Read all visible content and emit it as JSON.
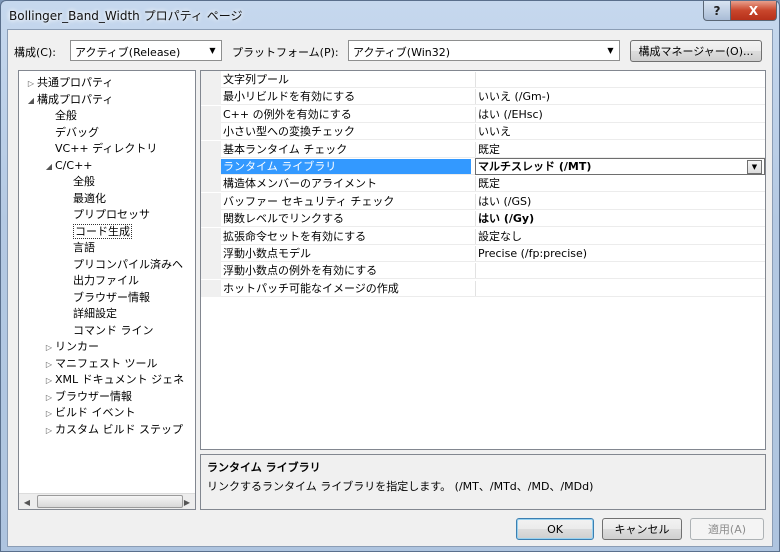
{
  "window": {
    "title": "Bollinger_Band_Width プロパティ ページ",
    "help_glyph": "?",
    "close_glyph": "X"
  },
  "toolbar": {
    "config_label": "構成(C):",
    "config_value": "アクティブ(Release)",
    "platform_label": "プラットフォーム(P):",
    "platform_value": "アクティブ(Win32)",
    "config_manager_button": "構成マネージャー(O)..."
  },
  "tree": {
    "expand_glyph": "▷",
    "collapse_glyph": "◢",
    "items": [
      {
        "label": "共通プロパティ",
        "level": 0,
        "state": "collapsed"
      },
      {
        "label": "構成プロパティ",
        "level": 0,
        "state": "expanded"
      },
      {
        "label": "全般",
        "level": 1,
        "state": "leaf"
      },
      {
        "label": "デバッグ",
        "level": 1,
        "state": "leaf"
      },
      {
        "label": "VC++ ディレクトリ",
        "level": 1,
        "state": "leaf"
      },
      {
        "label": "C/C++",
        "level": 1,
        "state": "expanded"
      },
      {
        "label": "全般",
        "level": 2,
        "state": "leaf"
      },
      {
        "label": "最適化",
        "level": 2,
        "state": "leaf"
      },
      {
        "label": "プリプロセッサ",
        "level": 2,
        "state": "leaf"
      },
      {
        "label": "コード生成",
        "level": 2,
        "state": "leaf",
        "selected": true
      },
      {
        "label": "言語",
        "level": 2,
        "state": "leaf"
      },
      {
        "label": "プリコンパイル済みヘ",
        "level": 2,
        "state": "leaf"
      },
      {
        "label": "出力ファイル",
        "level": 2,
        "state": "leaf"
      },
      {
        "label": "ブラウザー情報",
        "level": 2,
        "state": "leaf"
      },
      {
        "label": "詳細設定",
        "level": 2,
        "state": "leaf"
      },
      {
        "label": "コマンド ライン",
        "level": 2,
        "state": "leaf"
      },
      {
        "label": "リンカー",
        "level": 1,
        "state": "collapsed"
      },
      {
        "label": "マニフェスト ツール",
        "level": 1,
        "state": "collapsed"
      },
      {
        "label": "XML ドキュメント ジェネ",
        "level": 1,
        "state": "collapsed"
      },
      {
        "label": "ブラウザー情報",
        "level": 1,
        "state": "collapsed"
      },
      {
        "label": "ビルド イベント",
        "level": 1,
        "state": "collapsed"
      },
      {
        "label": "カスタム ビルド ステップ",
        "level": 1,
        "state": "collapsed"
      }
    ],
    "scroll_left_glyph": "◀",
    "scroll_right_glyph": "▶"
  },
  "properties": {
    "rows": [
      {
        "name": "文字列プール",
        "value": "",
        "bold": false
      },
      {
        "name": "最小リビルドを有効にする",
        "value": "いいえ (/Gm-)",
        "bold": false
      },
      {
        "name": "C++ の例外を有効にする",
        "value": "はい (/EHsc)",
        "bold": false
      },
      {
        "name": "小さい型への変換チェック",
        "value": "いいえ",
        "bold": false
      },
      {
        "name": "基本ランタイム チェック",
        "value": "既定",
        "bold": false
      },
      {
        "name": "ランタイム ライブラリ",
        "value": "マルチスレッド (/MT)",
        "bold": true,
        "selected": true
      },
      {
        "name": "構造体メンバーのアライメント",
        "value": "既定",
        "bold": false
      },
      {
        "name": "バッファー セキュリティ チェック",
        "value": "はい (/GS)",
        "bold": false
      },
      {
        "name": "関数レベルでリンクする",
        "value": "はい (/Gy)",
        "bold": true
      },
      {
        "name": "拡張命令セットを有効にする",
        "value": "設定なし",
        "bold": false
      },
      {
        "name": "浮動小数点モデル",
        "value": "Precise (/fp:precise)",
        "bold": false
      },
      {
        "name": "浮動小数点の例外を有効にする",
        "value": "",
        "bold": false
      },
      {
        "name": "ホットパッチ可能なイメージの作成",
        "value": "",
        "bold": false
      }
    ],
    "dropdown_glyph": "▼"
  },
  "description": {
    "title": "ランタイム ライブラリ",
    "text": "リンクするランタイム ライブラリを指定します。     (/MT、/MTd、/MD、/MDd)"
  },
  "footer": {
    "ok": "OK",
    "cancel": "キャンセル",
    "apply": "適用(A)"
  },
  "combo_arrow_glyph": "▼"
}
